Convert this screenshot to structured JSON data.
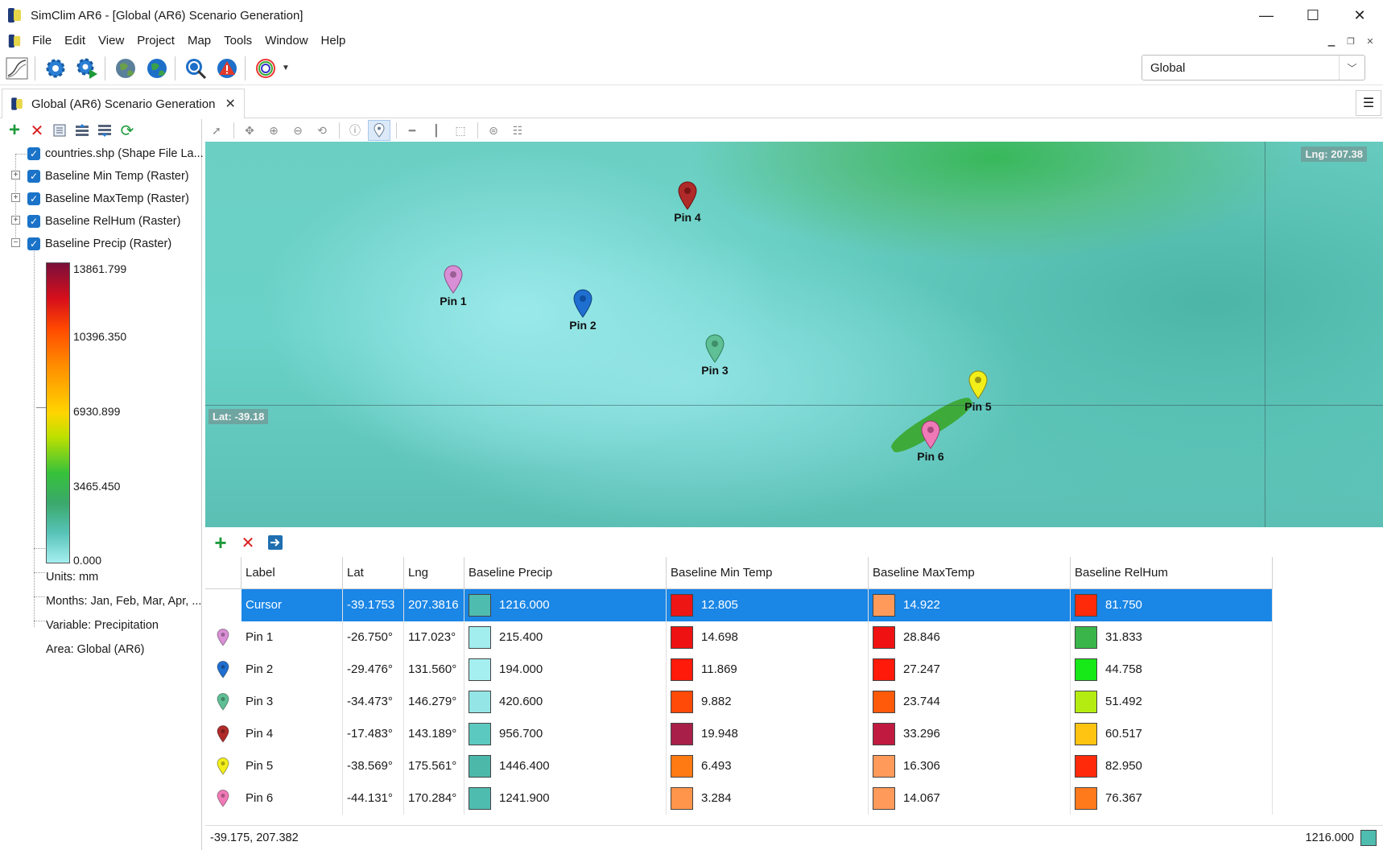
{
  "window": {
    "title": "SimClim AR6 - [Global (AR6) Scenario Generation]",
    "minimize_glyph": "—",
    "maximize_glyph": "☐",
    "close_glyph": "✕"
  },
  "menu": [
    "File",
    "Edit",
    "View",
    "Project",
    "Map",
    "Tools",
    "Window",
    "Help"
  ],
  "toolbar": {
    "icons": [
      "chart-icon",
      "gear-icon",
      "gear-run-icon",
      "globe-icon",
      "globe-blue-icon",
      "zoom-globe-icon",
      "warning-globe-icon",
      "spectrum-icon"
    ],
    "region_value": "Global"
  },
  "document_tab": {
    "label": "Global (AR6) Scenario Generation"
  },
  "layers": {
    "items": [
      {
        "label": "countries.shp (Shape File La..."
      },
      {
        "label": "Baseline Min Temp (Raster)"
      },
      {
        "label": "Baseline MaxTemp (Raster)"
      },
      {
        "label": "Baseline RelHum (Raster)"
      },
      {
        "label": "Baseline Precip (Raster)"
      }
    ],
    "legend_labels": [
      "13861.799",
      "10396.350",
      "6930.899",
      "3465.450",
      "0.000"
    ],
    "units": "Units: mm",
    "months": "Months: Jan, Feb, Mar, Apr, ...",
    "variable": "Variable: Precipitation",
    "area": "Area: Global (AR6)"
  },
  "map": {
    "lng_readout": "Lng: 207.38",
    "lat_readout": "Lat: -39.18",
    "pins": [
      {
        "label": "Pin 1",
        "color": "#d98fd6"
      },
      {
        "label": "Pin 2",
        "color": "#1f6fd0"
      },
      {
        "label": "Pin 3",
        "color": "#5fbf95"
      },
      {
        "label": "Pin 4",
        "color": "#b02a2a"
      },
      {
        "label": "Pin 5",
        "color": "#f2ee1a"
      },
      {
        "label": "Pin 6",
        "color": "#f07ab8"
      }
    ]
  },
  "grid": {
    "headers": [
      "Label",
      "Lat",
      "Lng",
      "Baseline Precip",
      "Baseline Min Temp",
      "Baseline MaxTemp",
      "Baseline RelHum"
    ],
    "rows": [
      {
        "label": "Cursor",
        "lat": "-39.1753",
        "lng": "207.3816",
        "precip": "1216.000",
        "precip_color": "#4fbcb0",
        "min": "12.805",
        "min_color": "#ee1515",
        "max": "14.922",
        "max_color": "#ff9a5a",
        "rh": "81.750",
        "rh_color": "#ff2a0a"
      },
      {
        "label": "Pin 1",
        "lat": "-26.750°",
        "lng": "117.023°",
        "precip": "215.400",
        "precip_color": "#a2edee",
        "min": "14.698",
        "min_color": "#ee1212",
        "max": "28.846",
        "max_color": "#f01212",
        "rh": "31.833",
        "rh_color": "#39b54a"
      },
      {
        "label": "Pin 2",
        "lat": "-29.476°",
        "lng": "131.560°",
        "precip": "194.000",
        "precip_color": "#a6eff0",
        "min": "11.869",
        "min_color": "#ff1a0a",
        "max": "27.247",
        "max_color": "#ff1a0a",
        "rh": "44.758",
        "rh_color": "#17e817"
      },
      {
        "label": "Pin 3",
        "lat": "-34.473°",
        "lng": "146.279°",
        "precip": "420.600",
        "precip_color": "#94e5e6",
        "min": "9.882",
        "min_color": "#ff4a08",
        "max": "23.744",
        "max_color": "#ff5a0a",
        "rh": "51.492",
        "rh_color": "#b4ec12"
      },
      {
        "label": "Pin 4",
        "lat": "-17.483°",
        "lng": "143.189°",
        "precip": "956.700",
        "precip_color": "#5cc9c0",
        "min": "19.948",
        "min_color": "#a8204a",
        "max": "33.296",
        "max_color": "#c01a40",
        "rh": "60.517",
        "rh_color": "#ffc412"
      },
      {
        "label": "Pin 5",
        "lat": "-38.569°",
        "lng": "175.561°",
        "precip": "1446.400",
        "precip_color": "#4cb8aa",
        "min": "6.493",
        "min_color": "#ff7a12",
        "max": "16.306",
        "max_color": "#ff9a5a",
        "rh": "82.950",
        "rh_color": "#ff2a0a"
      },
      {
        "label": "Pin 6",
        "lat": "-44.131°",
        "lng": "170.284°",
        "precip": "1241.900",
        "precip_color": "#4fbcb0",
        "min": "3.284",
        "min_color": "#ff954a",
        "max": "14.067",
        "max_color": "#ff9a5a",
        "rh": "76.367",
        "rh_color": "#ff7a1a"
      }
    ]
  },
  "status": {
    "coords": "-39.175, 207.382",
    "value": "1216.000",
    "value_color": "#4fbcb0"
  }
}
